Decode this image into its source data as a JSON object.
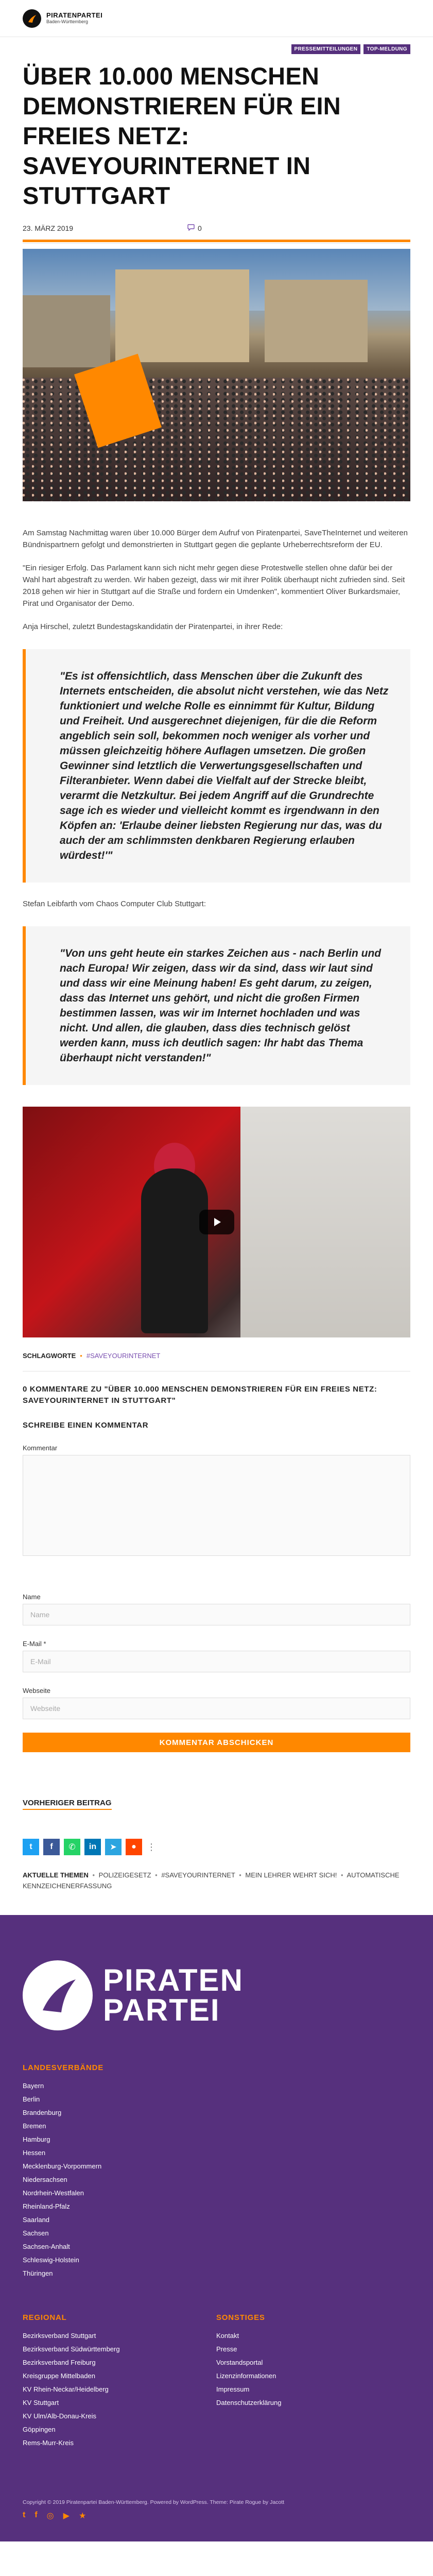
{
  "header": {
    "logo_line1": "PIRATENPARTEI",
    "logo_line2": "Baden-Württemberg"
  },
  "article": {
    "badges": [
      "PRESSEMITTEILUNGEN",
      "TOP-MELDUNG"
    ],
    "title": "ÜBER 10.000 MENSCHEN DEMONSTRIEREN FÜR EIN FREIES NETZ: SAVEYOURINTERNET IN STUTTGART",
    "date": "23. MÄRZ 2019",
    "comment_count": "0",
    "p1": "Am Samstag Nachmittag waren über 10.000 Bürger dem Aufruf von Piratenpartei, SaveTheInternet und weiteren Bündnispartnern gefolgt und demonstrierten in Stuttgart gegen die geplante Urheberrechtsreform der EU.",
    "p2": "\"Ein riesiger Erfolg. Das Parlament kann sich nicht mehr gegen diese Protestwelle stellen ohne dafür bei der Wahl hart abgestraft zu werden. Wir haben gezeigt, dass wir mit ihrer Politik überhaupt nicht zufrieden sind. Seit 2018 gehen wir hier in Stuttgart auf die Straße und fordern ein Umdenken\", kommentiert Oliver Burkardsmaier, Pirat und Organisator der Demo.",
    "p3": "Anja Hirschel, zuletzt Bundestagskandidatin der Piratenpartei, in ihrer Rede:",
    "quote1": "\"Es ist offensichtlich, dass Menschen über die Zukunft des Internets entscheiden, die absolut nicht verstehen, wie das Netz funktioniert und welche Rolle es einnimmt für Kultur, Bildung und Freiheit. Und ausgerechnet diejenigen, für die die Reform angeblich sein soll, bekommen noch weniger als vorher und müssen gleichzeitig höhere Auflagen umsetzen. Die großen Gewinner sind letztlich die Verwertungsgesellschaften und Filteranbieter. Wenn dabei die Vielfalt auf der Strecke bleibt, verarmt die Netzkultur. Bei jedem Angriff auf die Grundrechte sage ich es wieder und vielleicht kommt es irgendwann in den Köpfen an: 'Erlaube deiner liebsten Regierung nur das, was du auch der am schlimmsten denkbaren Regierung erlauben würdest!'\"",
    "p4": "Stefan Leibfarth vom Chaos Computer Club Stuttgart:",
    "quote2": "\"Von uns geht heute ein starkes Zeichen aus - nach Berlin und nach Europa! Wir zeigen, dass wir da sind, dass wir laut sind und dass wir eine Meinung haben! Es geht darum, zu zeigen, dass das Internet uns gehört, und nicht die großen Firmen bestimmen lassen, was wir im Internet hochladen und was nicht. Und allen, die glauben, dass dies technisch gelöst werden kann, muss ich deutlich sagen: Ihr habt das Thema überhaupt nicht verstanden!\"",
    "tags_label": "SCHLAGWORTE",
    "tag": "#SAVEYOURINTERNET"
  },
  "comments": {
    "heading": "0 KOMMENTARE ZU \"ÜBER 10.000 MENSCHEN DEMONSTRIEREN FÜR EIN FREIES NETZ: SAVEYOURINTERNET IN STUTTGART\"",
    "write_heading": "SCHREIBE EINEN KOMMENTAR",
    "comment_label": "Kommentar",
    "name_label": "Name",
    "name_placeholder": "Name",
    "email_label": "E-Mail *",
    "email_placeholder": "E-Mail",
    "website_label": "Webseite",
    "website_placeholder": "Webseite",
    "submit": "KOMMENTAR ABSCHICKEN"
  },
  "nav": {
    "previous": "VORHERIGER BEITRAG"
  },
  "trending": {
    "lead": "AKTUELLE THEMEN",
    "items": [
      "POLIZEIGESETZ",
      "#SAVEYOURINTERNET",
      "MEIN LEHRER WEHRT SICH!",
      "AUTOMATISCHE KENNZEICHENERFASSUNG"
    ]
  },
  "footer": {
    "logo_l1": "PIRATEN",
    "logo_l2": "PARTEI",
    "landesverbaende_title": "LANDESVERBÄNDE",
    "landesverbaende": [
      "Bayern",
      "Berlin",
      "Brandenburg",
      "Bremen",
      "Hamburg",
      "Hessen",
      "Mecklenburg-Vorpommern",
      "Niedersachsen",
      "Nordrhein-Westfalen",
      "Rheinland-Pfalz",
      "Saarland",
      "Sachsen",
      "Sachsen-Anhalt",
      "Schleswig-Holstein",
      "Thüringen"
    ],
    "regional_title": "REGIONAL",
    "regional": [
      "Bezirksverband Stuttgart",
      "Bezirksverband Südwürttemberg",
      "Bezirksverband Freiburg",
      "Kreisgruppe Mittelbaden",
      "KV Rhein-Neckar/Heidelberg",
      "KV Stuttgart",
      "KV Ulm/Alb-Donau-Kreis",
      "Göppingen",
      "Rems-Murr-Kreis"
    ],
    "sonstiges_title": "SONSTIGES",
    "sonstiges": [
      "Kontakt",
      "Presse",
      "Vorstandsportal",
      "Lizenzinformationen",
      "Impressum",
      "Datenschutzerklärung"
    ],
    "copyright": "Copyright © 2019 Piratenpartei Baden-Württemberg. Powered by WordPress. Theme: Pirate Rogue by Jacott"
  },
  "colors": {
    "accent": "#ff8800",
    "brand_purple": "#56307d",
    "tag_purple": "#7a4fb0"
  }
}
